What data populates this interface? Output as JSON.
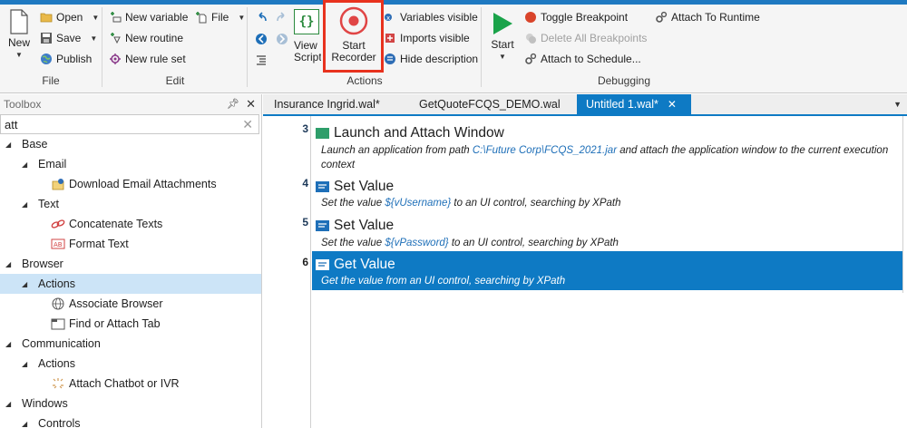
{
  "ribbon": {
    "file_group": {
      "label": "File",
      "new_label": "New",
      "open_label": "Open",
      "save_label": "Save",
      "publish_label": "Publish"
    },
    "edit_group": {
      "label": "Edit",
      "new_variable_label": "New variable",
      "file_label": "File",
      "new_routine_label": "New routine",
      "new_rule_set_label": "New rule set"
    },
    "actions_group": {
      "label": "Actions",
      "view_script_label": "View Script",
      "start_recorder_line1": "Start",
      "start_recorder_line2": "Recorder",
      "variables_visible_label": "Variables visible",
      "imports_visible_label": "Imports visible",
      "hide_description_label": "Hide description"
    },
    "debugging_group": {
      "label": "Debugging",
      "start_label": "Start",
      "toggle_breakpoint_label": "Toggle Breakpoint",
      "delete_all_breakpoints_label": "Delete All Breakpoints",
      "attach_to_schedule_label": "Attach to Schedule...",
      "attach_to_runtime_label": "Attach To Runtime"
    }
  },
  "toolbox": {
    "title": "Toolbox",
    "search_value": "att",
    "items": [
      {
        "label": "Base"
      },
      {
        "label": "Email"
      },
      {
        "label": "Download Email Attachments"
      },
      {
        "label": "Text"
      },
      {
        "label": "Concatenate Texts"
      },
      {
        "label": "Format Text"
      },
      {
        "label": "Browser"
      },
      {
        "label": "Actions"
      },
      {
        "label": "Associate Browser"
      },
      {
        "label": "Find or Attach Tab"
      },
      {
        "label": "Communication"
      },
      {
        "label": "Actions"
      },
      {
        "label": "Attach Chatbot or IVR"
      },
      {
        "label": "Windows"
      },
      {
        "label": "Controls"
      }
    ]
  },
  "tabs": [
    {
      "label": "Insurance Ingrid.wal*"
    },
    {
      "label": "GetQuoteFCQS_DEMO.wal"
    },
    {
      "label": "Untitled 1.wal*"
    }
  ],
  "steps": [
    {
      "line": "3",
      "title": "Launch and Attach Window",
      "desc_pre": "Launch an application from path ",
      "desc_link": "C:\\Future Corp\\FCQS_2021.jar",
      "desc_post": " and attach the application window to the current execution context"
    },
    {
      "line": "4",
      "title": "Set Value",
      "desc_pre": "Set the value ",
      "desc_link": "${vUsername}",
      "desc_post": " to an UI control, searching by XPath"
    },
    {
      "line": "5",
      "title": "Set Value",
      "desc_pre": "Set the value ",
      "desc_link": "${vPassword}",
      "desc_post": " to an UI control, searching by XPath"
    },
    {
      "line": "6",
      "title": "Get Value",
      "desc_pre": "Get the value from an UI control, searching by XPath"
    }
  ],
  "colors": {
    "accent": "#0e7ac4",
    "highlight_box": "#e8321e",
    "start_green": "#1aa34a",
    "breakpoint_red": "#d9442a"
  }
}
